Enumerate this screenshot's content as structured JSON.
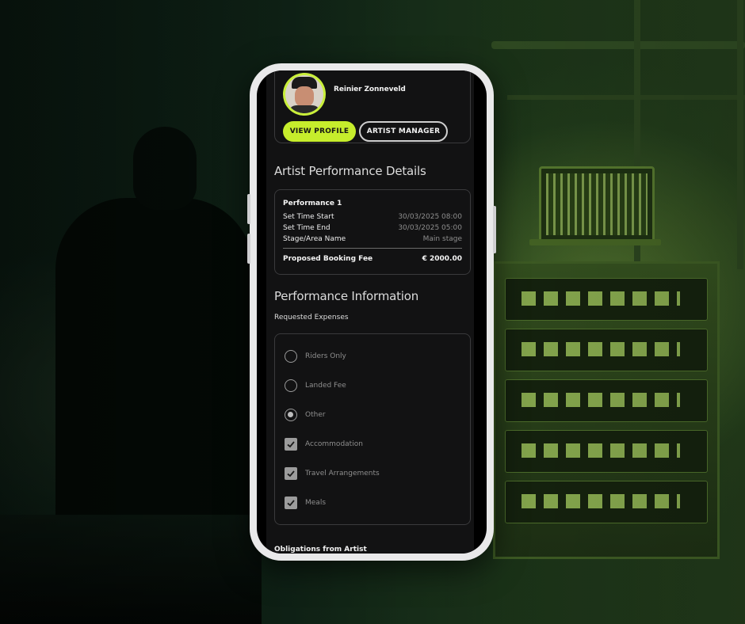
{
  "artist": {
    "name": "Reinier Zonneveld",
    "view_profile_label": "VIEW PROFILE",
    "artist_manager_label": "ARTIST MANAGER"
  },
  "performance_details": {
    "heading": "Artist Performance Details",
    "card_title": "Performance 1",
    "rows": [
      {
        "key": "Set Time Start",
        "value": "30/03/2025 08:00"
      },
      {
        "key": "Set Time End",
        "value": "30/03/2025 05:00"
      },
      {
        "key": "Stage/Area Name",
        "value": "Main stage"
      }
    ],
    "fee_label": "Proposed Booking Fee",
    "fee_value": "€ 2000.00"
  },
  "performance_info": {
    "heading": "Performance Information",
    "requested_expenses_label": "Requested Expenses",
    "options": [
      {
        "type": "radio",
        "label": "Riders Only",
        "checked": false
      },
      {
        "type": "radio",
        "label": "Landed Fee",
        "checked": false
      },
      {
        "type": "radio",
        "label": "Other",
        "checked": true
      },
      {
        "type": "checkbox",
        "label": "Accommodation",
        "checked": true
      },
      {
        "type": "checkbox",
        "label": "Travel Arrangements",
        "checked": true
      },
      {
        "type": "checkbox",
        "label": "Meals",
        "checked": true
      }
    ],
    "obligations_label": "Obligations from Artist"
  },
  "colors": {
    "accent": "#c6ed2c",
    "screen_bg": "#121213"
  },
  "icons": [
    "avatar",
    "radio",
    "checkbox-check"
  ]
}
